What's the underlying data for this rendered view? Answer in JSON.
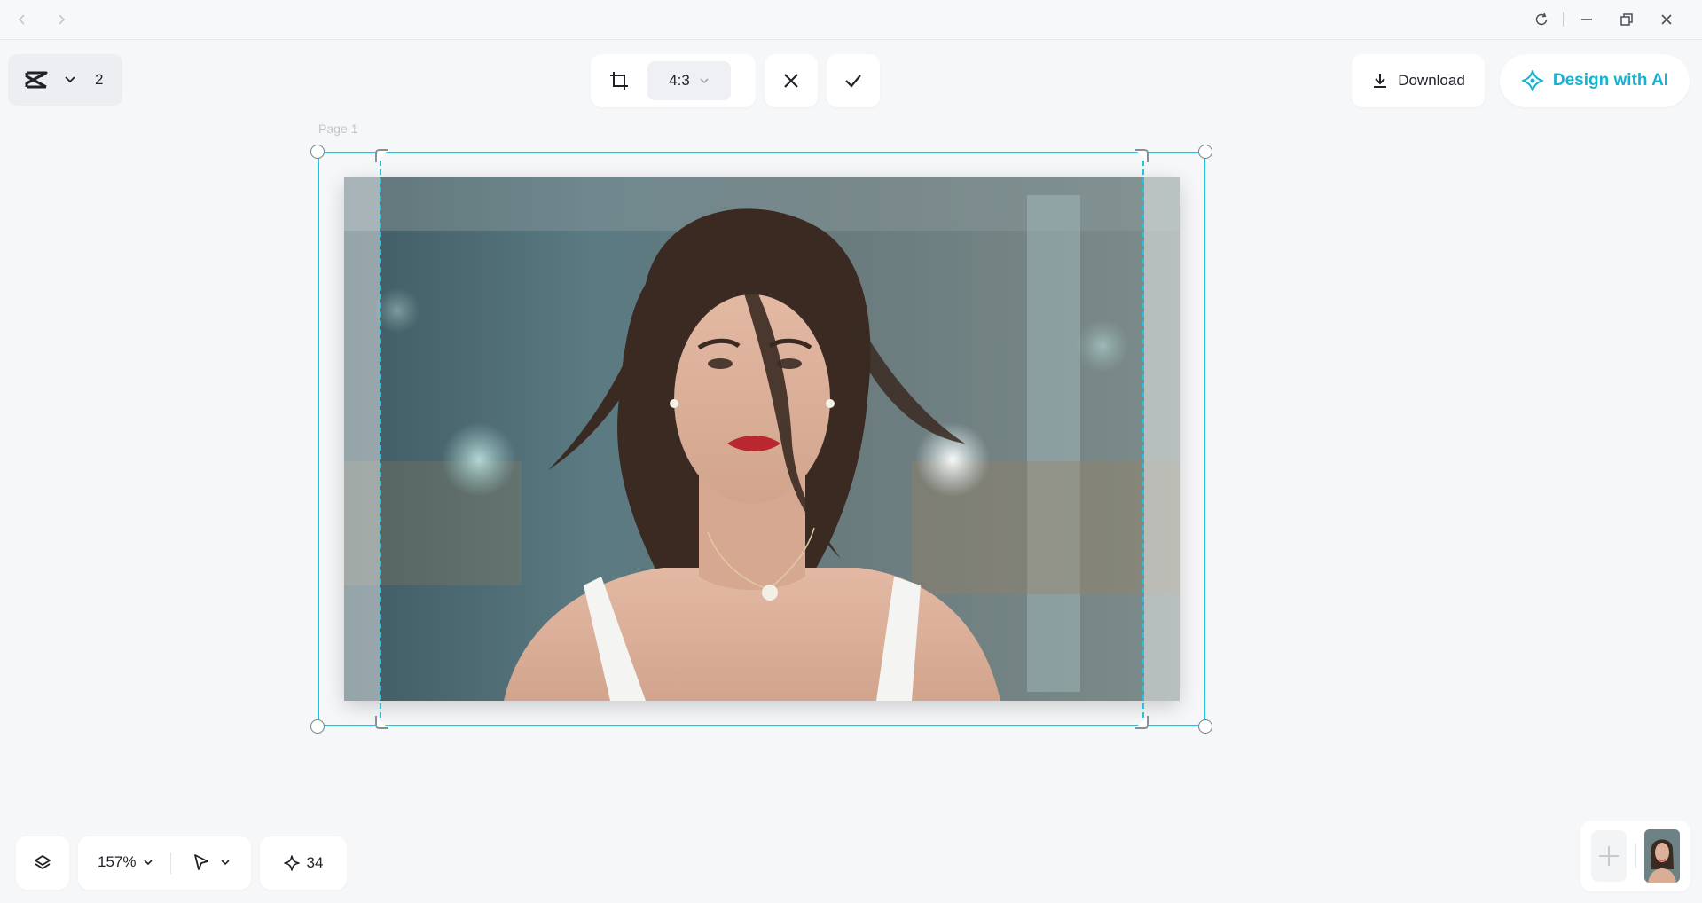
{
  "titlebar": {
    "back_icon": "chevron-left-icon",
    "forward_icon": "chevron-right-icon",
    "refresh_icon": "refresh-icon",
    "minimize_icon": "minimize-icon",
    "restore_icon": "restore-icon",
    "close_icon": "close-icon"
  },
  "workspace": {
    "logo_icon": "capcut-logo-icon",
    "count": "2"
  },
  "crop_toolbar": {
    "crop_icon": "crop-icon",
    "ratio": "4:3",
    "cancel_icon": "close-icon",
    "confirm_icon": "check-icon"
  },
  "header_actions": {
    "download_label": "Download",
    "design_ai_label": "Design with AI"
  },
  "canvas": {
    "page_label": "Page 1",
    "image_description": "portrait photo"
  },
  "bottom_bar": {
    "zoom": "157%",
    "credits": "34"
  },
  "colors": {
    "accent": "#15b3d1",
    "selection": "#20c3e0",
    "background": "#f6f7f9"
  }
}
